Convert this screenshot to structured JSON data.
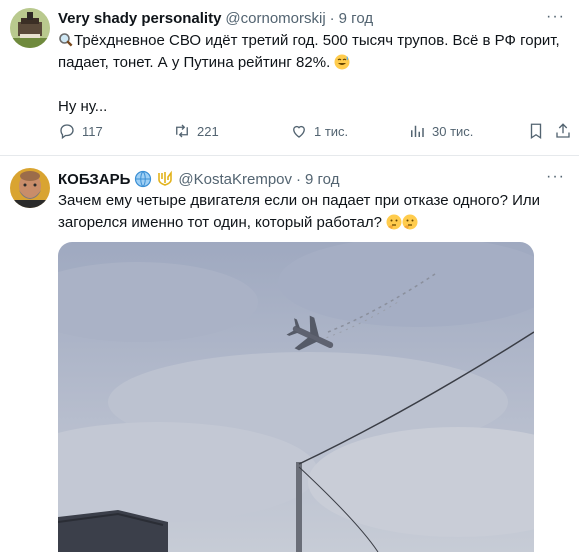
{
  "tweets": [
    {
      "name": "Very shady personality",
      "handle": "@cornomorskij",
      "dot": "·",
      "time": "9 год",
      "line1": "Трёхдневное СВО идёт третий год. 500 тысяч трупов. Всё в РФ горит,",
      "line2": "падает, тонет. А у Путина рейтинг 82%.",
      "line3": "Ну ну...",
      "replies": "117",
      "retweets": "221",
      "likes": "1 тис.",
      "views": "30 тис.",
      "more": "···"
    },
    {
      "name": "КОБЗАРЬ",
      "handle": "@KostaKrempov",
      "dot": "·",
      "time": "9 год",
      "line1": "Зачем ему четыре двигателя если он падает при отказе одного? Или",
      "line2": "загорелся именно тот один, который работал?",
      "more": "···"
    }
  ],
  "icons": [
    "magnifier-emoji",
    "sweat-smile-emoji",
    "globe-badge",
    "trident-badge",
    "thinking-emoji",
    "reply-icon",
    "retweet-icon",
    "like-icon",
    "views-icon",
    "bookmark-icon",
    "share-icon"
  ],
  "colors": {
    "text": "#0f1419",
    "muted": "#536471",
    "divider": "#e6e9ec"
  }
}
